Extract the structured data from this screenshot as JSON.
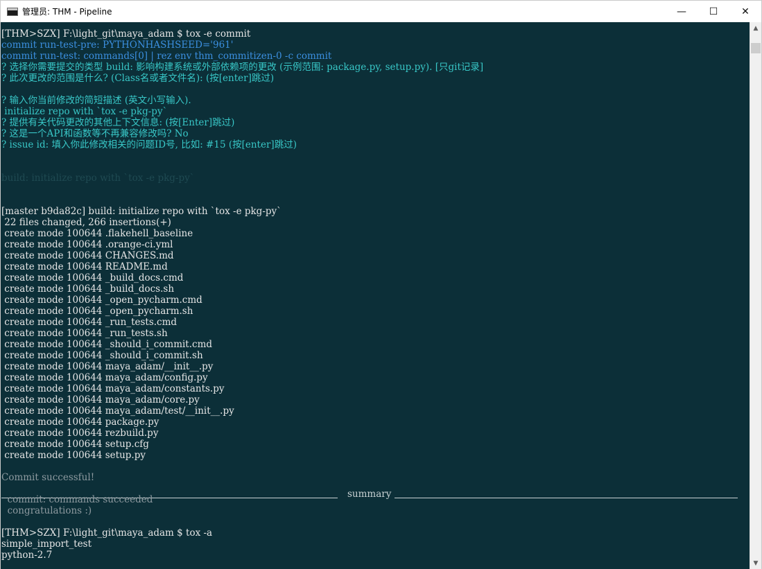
{
  "window": {
    "title": "管理员: THM - Pipeline"
  },
  "controls": {
    "minimize": "—",
    "maximize": "☐",
    "close": "✕"
  },
  "scrollbar": {
    "up": "▲",
    "down": "▼"
  },
  "console": {
    "lines": [
      {
        "text": "[THM>SZX] F:\\light_git\\maya_adam $ tox -e commit",
        "color": "white",
        "row": 1
      },
      {
        "text": "commit run-test-pre: PYTHONHASHSEED='961'",
        "color": "blue",
        "row": 2
      },
      {
        "text": "commit run-test: commands[0] | rez env thm_commitizen-0 -c commit",
        "color": "blue",
        "row": 3
      },
      {
        "text": "? 选择你需要提交的类型 build: 影响构建系统或外部依赖项的更改 (示例范围: package.py, setup.py). [只git记录]",
        "color": "cyan",
        "row": 4
      },
      {
        "text": "? 此次更改的范围是什么? (Class名或者文件名): (按[enter]跳过)",
        "color": "cyan",
        "row": 5
      },
      {
        "text": "? 输入你当前修改的简短描述 (英文小写输入).",
        "color": "cyan",
        "row": 7
      },
      {
        "text": " initialize repo with `tox -e pkg-py`",
        "color": "cyan",
        "row": 8
      },
      {
        "text": "? 提供有关代码更改的其他上下文信息: (按[Enter]跳过)",
        "color": "cyan",
        "row": 9
      },
      {
        "text": "? 这是一个API和函数等不再兼容修改吗? No",
        "color": "cyan",
        "row": 10
      },
      {
        "text": "? issue id: 填入你此修改相关的问题ID号, 比如: #15 (按[enter]跳过)",
        "color": "cyan",
        "row": 11
      },
      {
        "text": "build: initialize repo with `tox -e pkg-py`",
        "color": "ghost",
        "row": 14
      },
      {
        "text": "[master b9da82c] build: initialize repo with `tox -e pkg-py`",
        "color": "white",
        "row": 17
      },
      {
        "text": " 22 files changed, 266 insertions(+)",
        "color": "white",
        "row": 18
      },
      {
        "text": " create mode 100644 .flakehell_baseline",
        "color": "white",
        "row": 19
      },
      {
        "text": " create mode 100644 .orange-ci.yml",
        "color": "white",
        "row": 20
      },
      {
        "text": " create mode 100644 CHANGES.md",
        "color": "white",
        "row": 21
      },
      {
        "text": " create mode 100644 README.md",
        "color": "white",
        "row": 22
      },
      {
        "text": " create mode 100644 _build_docs.cmd",
        "color": "white",
        "row": 23
      },
      {
        "text": " create mode 100644 _build_docs.sh",
        "color": "white",
        "row": 24
      },
      {
        "text": " create mode 100644 _open_pycharm.cmd",
        "color": "white",
        "row": 25
      },
      {
        "text": " create mode 100644 _open_pycharm.sh",
        "color": "white",
        "row": 26
      },
      {
        "text": " create mode 100644 _run_tests.cmd",
        "color": "white",
        "row": 27
      },
      {
        "text": " create mode 100644 _run_tests.sh",
        "color": "white",
        "row": 28
      },
      {
        "text": " create mode 100644 _should_i_commit.cmd",
        "color": "white",
        "row": 29
      },
      {
        "text": " create mode 100644 _should_i_commit.sh",
        "color": "white",
        "row": 30
      },
      {
        "text": " create mode 100644 maya_adam/__init__.py",
        "color": "white",
        "row": 31
      },
      {
        "text": " create mode 100644 maya_adam/config.py",
        "color": "white",
        "row": 32
      },
      {
        "text": " create mode 100644 maya_adam/constants.py",
        "color": "white",
        "row": 33
      },
      {
        "text": " create mode 100644 maya_adam/core.py",
        "color": "white",
        "row": 34
      },
      {
        "text": " create mode 100644 maya_adam/test/__init__.py",
        "color": "white",
        "row": 35
      },
      {
        "text": " create mode 100644 package.py",
        "color": "white",
        "row": 36
      },
      {
        "text": " create mode 100644 rezbuild.py",
        "color": "white",
        "row": 37
      },
      {
        "text": " create mode 100644 setup.cfg",
        "color": "white",
        "row": 38
      },
      {
        "text": " create mode 100644 setup.py",
        "color": "white",
        "row": 39
      },
      {
        "text": "Commit successful!",
        "color": "gray",
        "row": 41
      },
      {
        "text": "  commit: commands succeeded",
        "color": "gray",
        "row": 43
      },
      {
        "text": "  congratulations :)",
        "color": "gray",
        "row": 44
      },
      {
        "text": "[THM>SZX] F:\\light_git\\maya_adam $ tox -a",
        "color": "white",
        "row": 46
      },
      {
        "text": "simple_import_test",
        "color": "white",
        "row": 47
      },
      {
        "text": "python-2.7",
        "color": "white",
        "row": 48
      }
    ],
    "summary_label": "summary"
  }
}
